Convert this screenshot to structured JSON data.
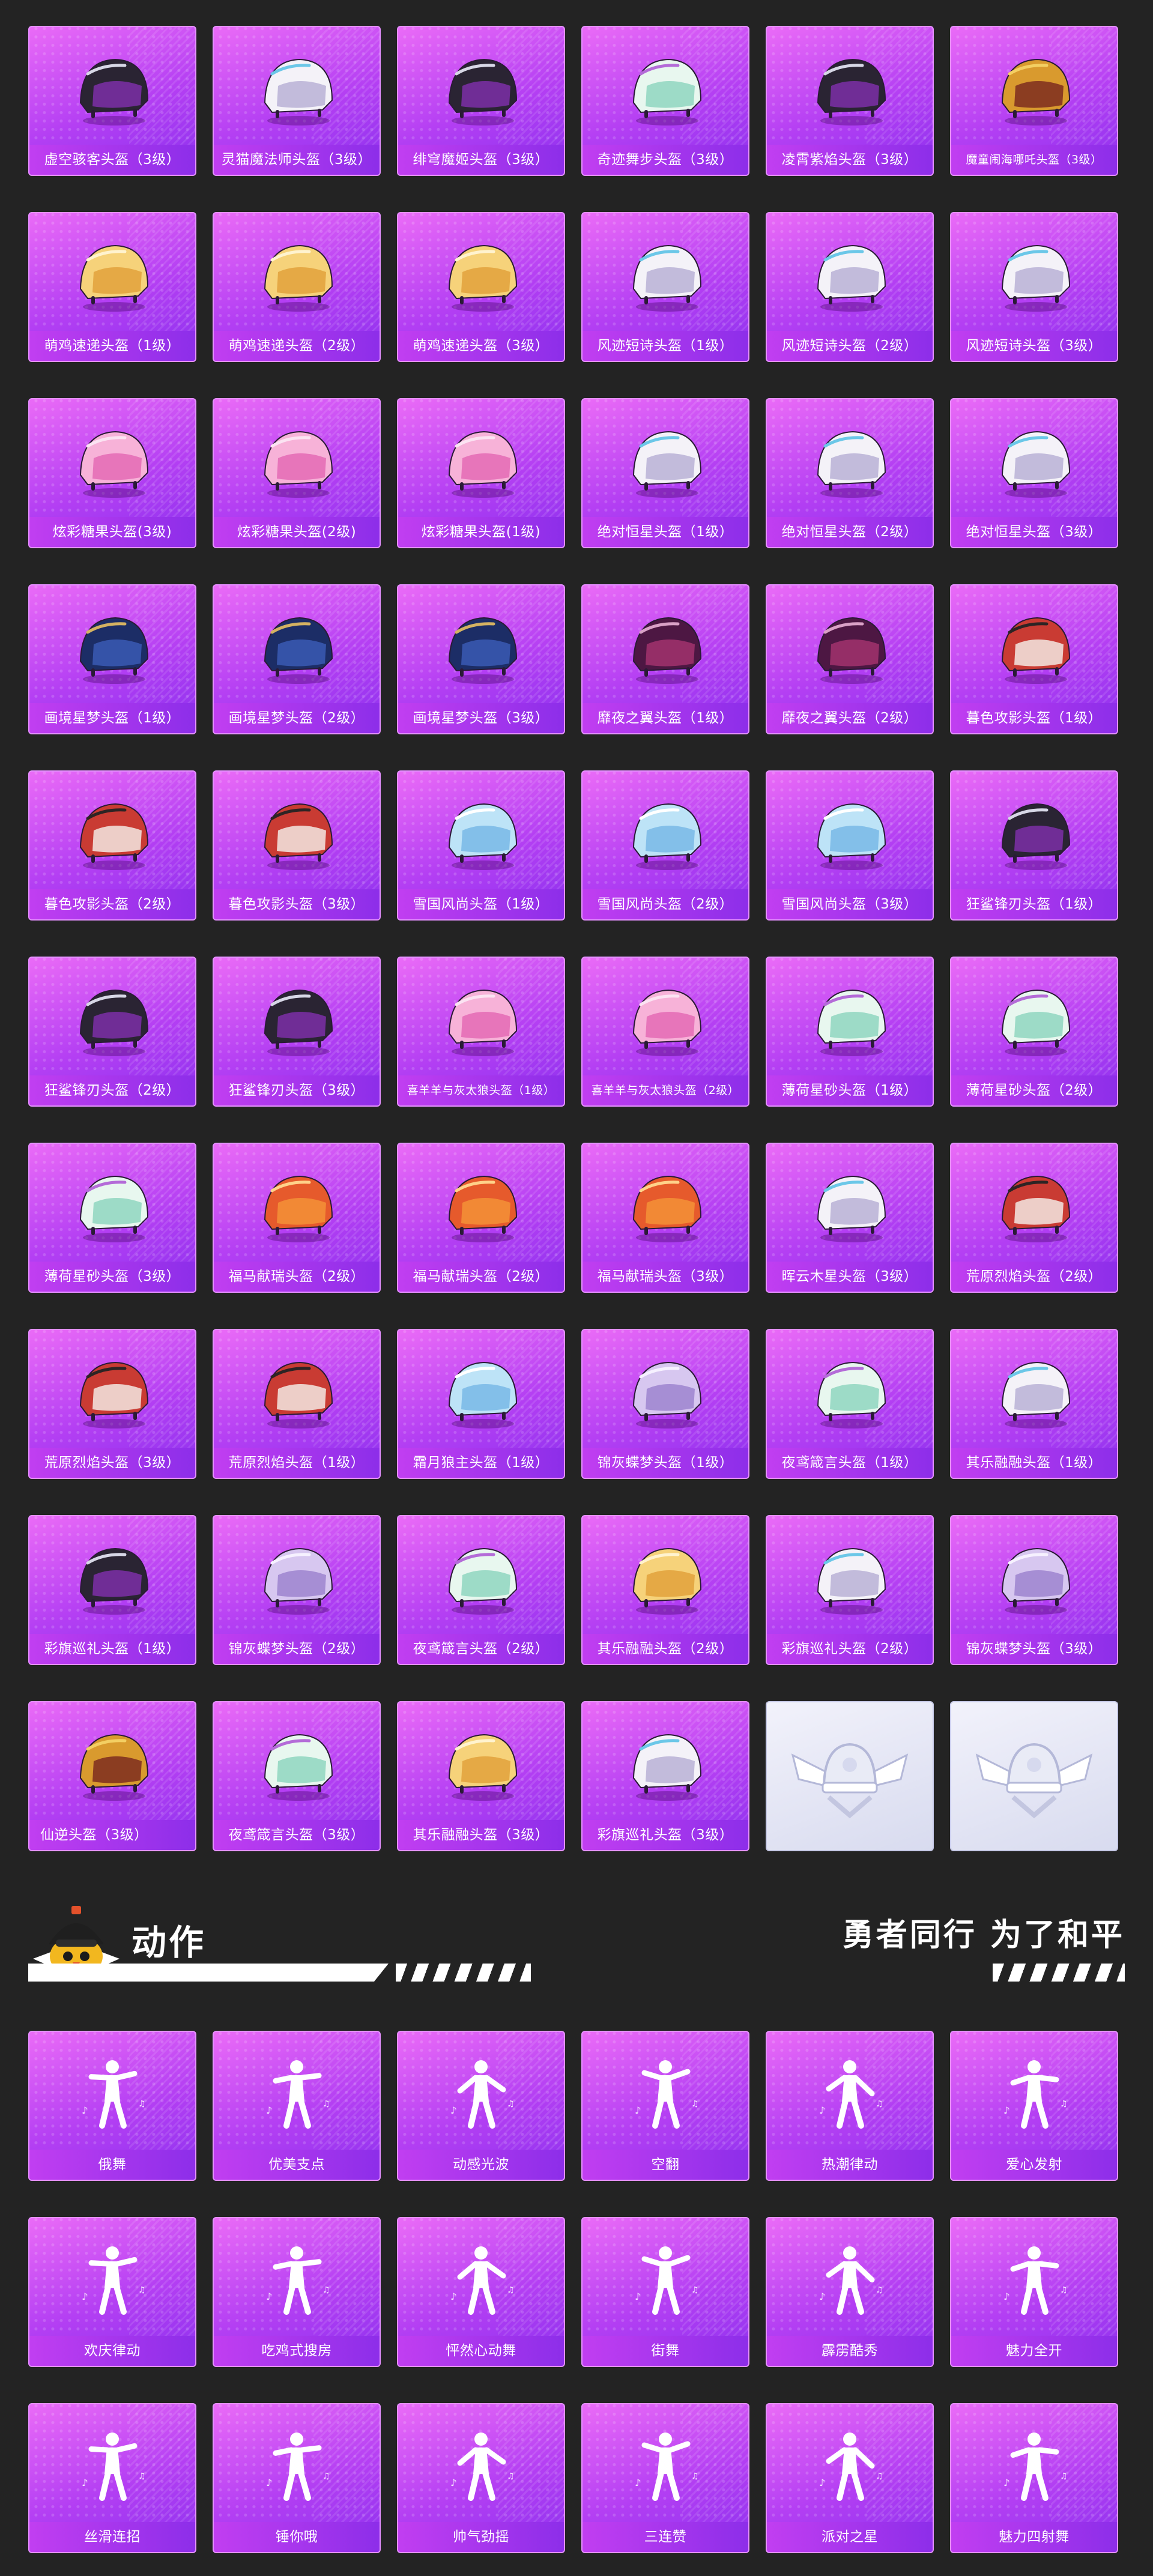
{
  "helmets": [
    {
      "name": "虚空骇客头盔（3级）",
      "icon": "helmet-void-hacker-icon",
      "theme": "dark"
    },
    {
      "name": "灵猫魔法师头盔（3级）",
      "icon": "helmet-spirit-cat-mage-icon",
      "theme": "white"
    },
    {
      "name": "绯穹魔姬头盔（3级）",
      "icon": "helmet-crimson-witch-icon",
      "theme": "dark"
    },
    {
      "name": "奇迹舞步头盔（3级）",
      "icon": "helmet-miracle-dance-icon",
      "theme": "mint"
    },
    {
      "name": "凌霄紫焰头盔（3级）",
      "icon": "helmet-violet-flame-icon",
      "theme": "dark"
    },
    {
      "name": "魔童闹海哪吒头盔（3级）",
      "icon": "helmet-nezha-icon",
      "theme": "gold",
      "small": true
    },
    {
      "name": "萌鸡速递头盔（1级）",
      "icon": "helmet-chick-courier-1-icon",
      "theme": "cream"
    },
    {
      "name": "萌鸡速递头盔（2级）",
      "icon": "helmet-chick-courier-2-icon",
      "theme": "cream"
    },
    {
      "name": "萌鸡速递头盔（3级）",
      "icon": "helmet-chick-courier-3-icon",
      "theme": "cream"
    },
    {
      "name": "风迹短诗头盔（1级）",
      "icon": "helmet-wind-poem-1-icon",
      "theme": "white"
    },
    {
      "name": "风迹短诗头盔（2级）",
      "icon": "helmet-wind-poem-2-icon",
      "theme": "white"
    },
    {
      "name": "风迹短诗头盔（3级）",
      "icon": "helmet-wind-poem-3-icon",
      "theme": "white"
    },
    {
      "name": "炫彩糖果头盔(3级)",
      "icon": "helmet-candy-3-icon",
      "theme": "pink"
    },
    {
      "name": "炫彩糖果头盔(2级)",
      "icon": "helmet-candy-2-icon",
      "theme": "pink"
    },
    {
      "name": "炫彩糖果头盔(1级)",
      "icon": "helmet-candy-1-icon",
      "theme": "pink"
    },
    {
      "name": "绝对恒星头盔（1级）",
      "icon": "helmet-stellar-1-icon",
      "theme": "white"
    },
    {
      "name": "绝对恒星头盔（2级）",
      "icon": "helmet-stellar-2-icon",
      "theme": "white"
    },
    {
      "name": "绝对恒星头盔（3级）",
      "icon": "helmet-stellar-3-icon",
      "theme": "white"
    },
    {
      "name": "画境星梦头盔（1级）",
      "icon": "helmet-dream-1-icon",
      "theme": "navy"
    },
    {
      "name": "画境星梦头盔（2级）",
      "icon": "helmet-dream-2-icon",
      "theme": "navy"
    },
    {
      "name": "画境星梦头盔（3级）",
      "icon": "helmet-dream-3-icon",
      "theme": "navy"
    },
    {
      "name": "靡夜之翼头盔（1级）",
      "icon": "helmet-night-wing-1-icon",
      "theme": "plum"
    },
    {
      "name": "靡夜之翼头盔（2级）",
      "icon": "helmet-night-wing-2-icon",
      "theme": "plum"
    },
    {
      "name": "暮色攻影头盔（1级）",
      "icon": "helmet-dusk-shadow-1-icon",
      "theme": "red"
    },
    {
      "name": "暮色攻影头盔（2级）",
      "icon": "helmet-dusk-shadow-2-icon",
      "theme": "red"
    },
    {
      "name": "暮色攻影头盔（3级）",
      "icon": "helmet-dusk-shadow-3-icon",
      "theme": "red"
    },
    {
      "name": "雪国风尚头盔（1级）",
      "icon": "helmet-snow-style-1-icon",
      "theme": "ice"
    },
    {
      "name": "雪国风尚头盔（2级）",
      "icon": "helmet-snow-style-2-icon",
      "theme": "ice"
    },
    {
      "name": "雪国风尚头盔（3级）",
      "icon": "helmet-snow-style-3-icon",
      "theme": "ice"
    },
    {
      "name": "狂鲨锋刃头盔（1级）",
      "icon": "helmet-shark-blade-1-icon",
      "theme": "dark"
    },
    {
      "name": "狂鲨锋刃头盔（2级）",
      "icon": "helmet-shark-blade-2-icon",
      "theme": "dark"
    },
    {
      "name": "狂鲨锋刃头盔（3级）",
      "icon": "helmet-shark-blade-3-icon",
      "theme": "dark"
    },
    {
      "name": "喜羊羊与灰太狼头盔（1级）",
      "icon": "helmet-pleasant-goat-1-icon",
      "theme": "pink",
      "small": true
    },
    {
      "name": "喜羊羊与灰太狼头盔（2级）",
      "icon": "helmet-pleasant-goat-2-icon",
      "theme": "pink",
      "small": true
    },
    {
      "name": "薄荷星砂头盔（1级）",
      "icon": "helmet-mint-sand-1-icon",
      "theme": "mint"
    },
    {
      "name": "薄荷星砂头盔（2级）",
      "icon": "helmet-mint-sand-2-icon",
      "theme": "mint"
    },
    {
      "name": "薄荷星砂头盔（3级）",
      "icon": "helmet-mint-sand-3-icon",
      "theme": "mint"
    },
    {
      "name": "福马献瑞头盔（2级）",
      "icon": "helmet-lucky-horse-2a-icon",
      "theme": "orange"
    },
    {
      "name": "福马献瑞头盔（2级）",
      "icon": "helmet-lucky-horse-2b-icon",
      "theme": "orange"
    },
    {
      "name": "福马献瑞头盔（3级）",
      "icon": "helmet-lucky-horse-3-icon",
      "theme": "orange"
    },
    {
      "name": "晖云木星头盔（3级）",
      "icon": "helmet-jupiter-cloud-3-icon",
      "theme": "white"
    },
    {
      "name": "荒原烈焰头盔（2级）",
      "icon": "helmet-wild-flame-2-icon",
      "theme": "red"
    },
    {
      "name": "荒原烈焰头盔（3级）",
      "icon": "helmet-wild-flame-3-icon",
      "theme": "red"
    },
    {
      "name": "荒原烈焰头盔（1级）",
      "icon": "helmet-wild-flame-1-icon",
      "theme": "red"
    },
    {
      "name": "霜月狼主头盔（1级）",
      "icon": "helmet-frost-wolf-1-icon",
      "theme": "ice"
    },
    {
      "name": "锦灰蝶梦头盔（1级）",
      "icon": "helmet-butterfly-1-icon",
      "theme": "lilac"
    },
    {
      "name": "夜鸢箴言头盔（1级）",
      "icon": "helmet-night-kite-1-icon",
      "theme": "mint"
    },
    {
      "name": "其乐融融头盔（1级）",
      "icon": "helmet-joy-1-icon",
      "theme": "white"
    },
    {
      "name": "彩旗巡礼头盔（1级）",
      "icon": "helmet-flag-parade-1-icon",
      "theme": "dark"
    },
    {
      "name": "锦灰蝶梦头盔（2级）",
      "icon": "helmet-butterfly-2-icon",
      "theme": "lilac"
    },
    {
      "name": "夜鸢箴言头盔（2级）",
      "icon": "helmet-night-kite-2-icon",
      "theme": "mint"
    },
    {
      "name": "其乐融融头盔（2级）",
      "icon": "helmet-joy-2-icon",
      "theme": "cream"
    },
    {
      "name": "彩旗巡礼头盔（2级）",
      "icon": "helmet-flag-parade-2-icon",
      "theme": "white"
    },
    {
      "name": "锦灰蝶梦头盔（3级）",
      "icon": "helmet-butterfly-3-icon",
      "theme": "lilac"
    },
    {
      "name": "仙逆头盔（3级）",
      "icon": "helmet-immortal-3-icon",
      "theme": "gold",
      "left": true
    },
    {
      "name": "夜鸢箴言头盔（3级）",
      "icon": "helmet-night-kite-3-icon",
      "theme": "mint"
    },
    {
      "name": "其乐融融头盔（3级）",
      "icon": "helmet-joy-3-icon",
      "theme": "cream"
    },
    {
      "name": "彩旗巡礼头盔（3级）",
      "icon": "helmet-flag-parade-3-icon",
      "theme": "white"
    }
  ],
  "placeholders": [
    {
      "icon": "winged-helmet-emblem-icon"
    },
    {
      "icon": "winged-helmet-emblem-icon"
    }
  ],
  "section": {
    "title": "动作",
    "slogan": "勇者同行 为了和平",
    "mascot_icon": "helmet-chick-mascot-icon"
  },
  "emotes": [
    {
      "name": "俄舞",
      "icon": "dance-pose-icon"
    },
    {
      "name": "优美支点",
      "icon": "graceful-pose-icon"
    },
    {
      "name": "动感光波",
      "icon": "light-wave-pose-icon"
    },
    {
      "name": "空翻",
      "icon": "flip-pose-icon"
    },
    {
      "name": "热潮律动",
      "icon": "groove-pose-icon"
    },
    {
      "name": "爱心发射",
      "icon": "heart-pose-icon"
    },
    {
      "name": "欢庆律动",
      "icon": "celebrate-pose-icon"
    },
    {
      "name": "吃鸡式搜房",
      "icon": "search-house-pose-icon"
    },
    {
      "name": "怦然心动舞",
      "icon": "heartbeat-pose-icon"
    },
    {
      "name": "街舞",
      "icon": "street-dance-pose-icon"
    },
    {
      "name": "霹雳酷秀",
      "icon": "breakdance-pose-icon"
    },
    {
      "name": "魅力全开",
      "icon": "charm-pose-icon"
    },
    {
      "name": "丝滑连招",
      "icon": "smooth-combo-pose-icon"
    },
    {
      "name": "锤你哦",
      "icon": "hammer-pose-icon"
    },
    {
      "name": "帅气劲摇",
      "icon": "cool-shake-pose-icon"
    },
    {
      "name": "三连赞",
      "icon": "triple-like-pose-icon"
    },
    {
      "name": "派对之星",
      "icon": "party-star-pose-icon"
    },
    {
      "name": "魅力四射舞",
      "icon": "radiant-dance-pose-icon"
    }
  ],
  "colors": {
    "background": "#232323",
    "card_gradient_top": "#ea6bf7",
    "card_gradient_bottom": "#8c31ef",
    "label_bar": "#a233ee",
    "text": "#ffffff"
  }
}
